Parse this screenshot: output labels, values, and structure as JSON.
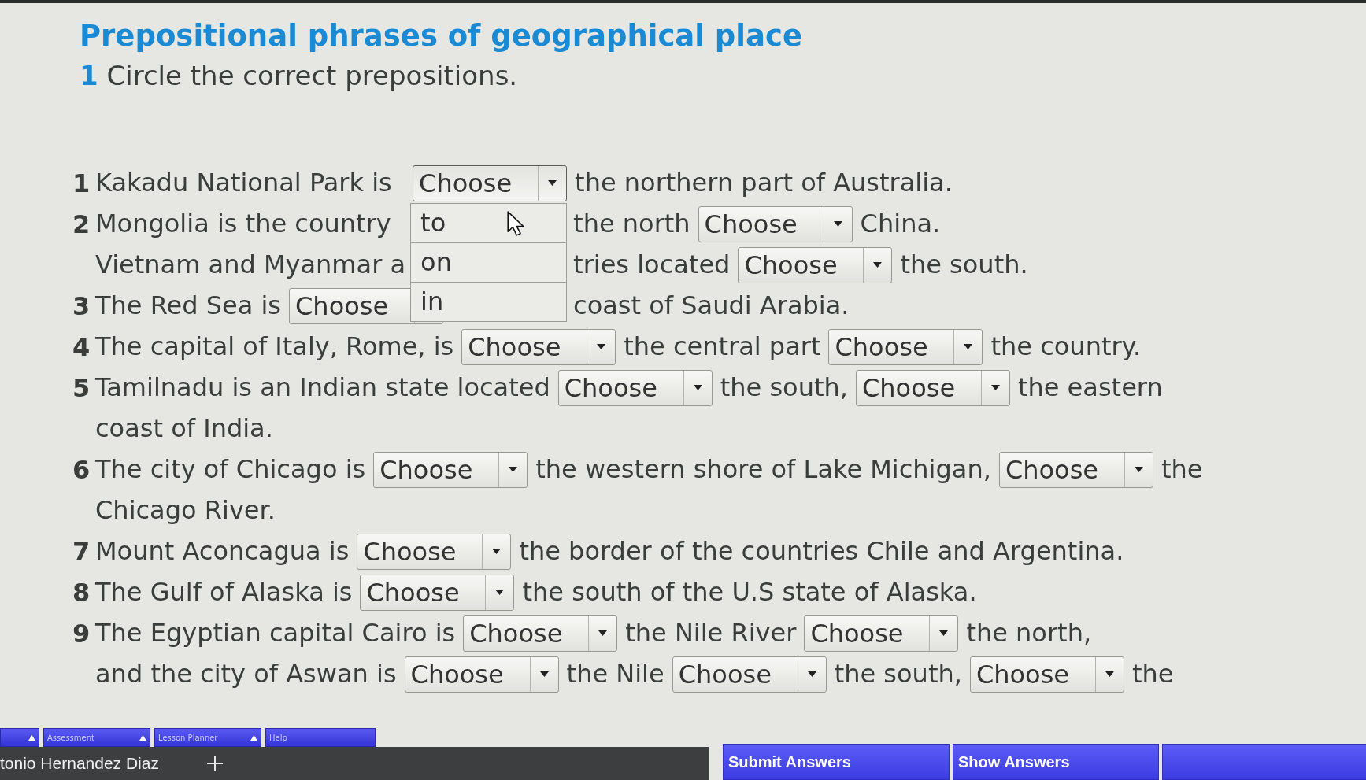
{
  "title": "Prepositional phrases of geographical place",
  "instruction": {
    "number": "1",
    "text": "Circle the correct prepositions."
  },
  "items": [
    {
      "number": "1",
      "lines": [
        {
          "segments": [
            {
              "kind": "text",
              "text": "Kakadu National Park is"
            },
            {
              "kind": "select",
              "value": "Choose",
              "expanded": true,
              "options": [
                {
                  "label": "to",
                  "selected": false,
                  "pointer": true
                },
                {
                  "label": "on",
                  "selected": false,
                  "pointer": false
                },
                {
                  "label": "in",
                  "selected": false,
                  "pointer": false
                }
              ]
            },
            {
              "kind": "text",
              "text": "the northern part of Australia."
            }
          ]
        }
      ]
    },
    {
      "number": "2",
      "lines": [
        {
          "segments": [
            {
              "kind": "text",
              "text": "Mongolia is the country"
            }
          ],
          "after_menu": [
            {
              "kind": "text",
              "text": "the north"
            },
            {
              "kind": "select",
              "value": "Choose",
              "expanded": false
            },
            {
              "kind": "text",
              "text": "China."
            }
          ]
        },
        {
          "segments": [
            {
              "kind": "text",
              "text": "Vietnam and Myanmar a"
            }
          ],
          "after_menu": [
            {
              "kind": "text",
              "text": "tries located"
            },
            {
              "kind": "select",
              "value": "Choose",
              "expanded": false
            },
            {
              "kind": "text",
              "text": "the south."
            }
          ]
        }
      ]
    },
    {
      "number": "3",
      "lines": [
        {
          "segments": [
            {
              "kind": "text",
              "text": "The Red Sea is"
            },
            {
              "kind": "select",
              "value": "Choose",
              "expanded": false
            }
          ],
          "after_menu": [
            {
              "kind": "text",
              "text": "coast of Saudi Arabia."
            }
          ]
        }
      ]
    },
    {
      "number": "4",
      "lines": [
        {
          "segments": [
            {
              "kind": "text",
              "text": "The capital of Italy, Rome, is"
            },
            {
              "kind": "select",
              "value": "Choose",
              "expanded": false
            },
            {
              "kind": "text",
              "text": "the central part"
            },
            {
              "kind": "select",
              "value": "Choose",
              "expanded": false
            },
            {
              "kind": "text",
              "text": "the country."
            }
          ]
        }
      ]
    },
    {
      "number": "5",
      "lines": [
        {
          "segments": [
            {
              "kind": "text",
              "text": "Tamilnadu is an Indian state located"
            },
            {
              "kind": "select",
              "value": "Choose",
              "expanded": false
            },
            {
              "kind": "text",
              "text": "the south,"
            },
            {
              "kind": "select",
              "value": "Choose",
              "expanded": false
            },
            {
              "kind": "text",
              "text": "the eastern"
            }
          ]
        },
        {
          "segments": [
            {
              "kind": "text",
              "text": "coast of India."
            }
          ]
        }
      ]
    },
    {
      "number": "6",
      "lines": [
        {
          "segments": [
            {
              "kind": "text",
              "text": "The city of Chicago is"
            },
            {
              "kind": "select",
              "value": "Choose",
              "expanded": false
            },
            {
              "kind": "text",
              "text": "the western shore of Lake Michigan,"
            },
            {
              "kind": "select",
              "value": "Choose",
              "expanded": false
            },
            {
              "kind": "text",
              "text": "the"
            }
          ]
        },
        {
          "segments": [
            {
              "kind": "text",
              "text": "Chicago River."
            }
          ]
        }
      ]
    },
    {
      "number": "7",
      "lines": [
        {
          "segments": [
            {
              "kind": "text",
              "text": "Mount Aconcagua is"
            },
            {
              "kind": "select",
              "value": "Choose",
              "expanded": false
            },
            {
              "kind": "text",
              "text": "the border of the countries Chile and Argentina."
            }
          ]
        }
      ]
    },
    {
      "number": "8",
      "lines": [
        {
          "segments": [
            {
              "kind": "text",
              "text": "The Gulf of Alaska is"
            },
            {
              "kind": "select",
              "value": "Choose",
              "expanded": false
            },
            {
              "kind": "text",
              "text": "the south of the U.S state of Alaska."
            }
          ]
        }
      ]
    },
    {
      "number": "9",
      "lines": [
        {
          "segments": [
            {
              "kind": "text",
              "text": "The Egyptian capital Cairo is"
            },
            {
              "kind": "select",
              "value": "Choose",
              "expanded": false
            },
            {
              "kind": "text",
              "text": "the Nile River"
            },
            {
              "kind": "select",
              "value": "Choose",
              "expanded": false
            },
            {
              "kind": "text",
              "text": "the north,"
            }
          ]
        },
        {
          "segments": [
            {
              "kind": "text",
              "text": "and the city of Aswan is"
            },
            {
              "kind": "select",
              "value": "Choose",
              "expanded": false
            },
            {
              "kind": "text",
              "text": "the Nile"
            },
            {
              "kind": "select",
              "value": "Choose",
              "expanded": false
            },
            {
              "kind": "text",
              "text": "the south,"
            },
            {
              "kind": "select",
              "value": "Choose",
              "expanded": false
            },
            {
              "kind": "text",
              "text": "the"
            }
          ]
        }
      ]
    }
  ],
  "footer": {
    "tabs": [
      {
        "arrow": true
      },
      {
        "label": "Assessment",
        "arrow": true
      },
      {
        "label": "Lesson Planner",
        "arrow": true
      },
      {
        "label": "Help",
        "arrow": false
      }
    ],
    "user": "tonio Hernandez Diaz",
    "buttons": [
      {
        "label": "Submit Answers"
      },
      {
        "label": "Show Answers"
      }
    ]
  }
}
